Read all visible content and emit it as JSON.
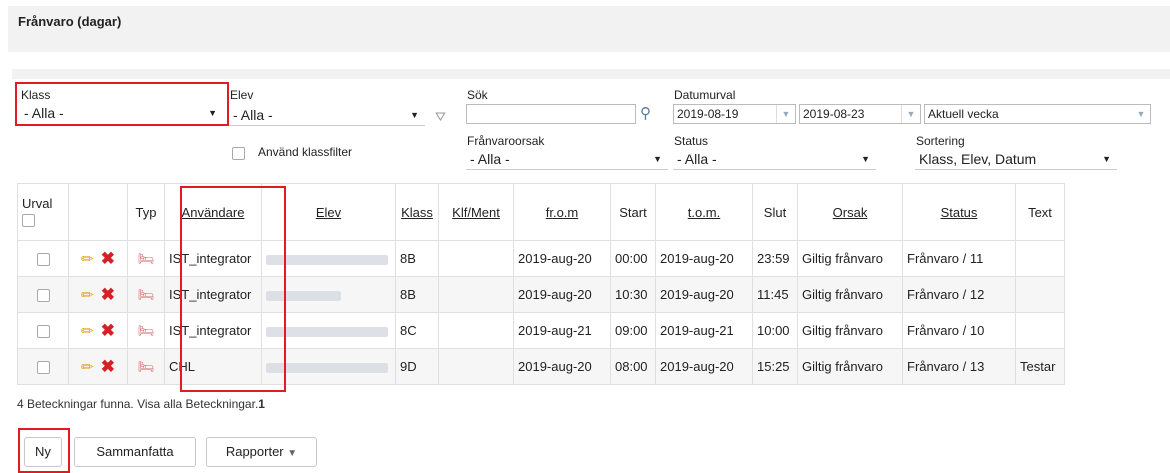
{
  "header": {
    "title": "Frånvaro (dagar)"
  },
  "filters": {
    "klass_label": "Klass",
    "klass_value": "- Alla -",
    "elev_label": "Elev",
    "elev_value": "- Alla -",
    "sok_label": "Sök",
    "sok_value": "",
    "datum_label": "Datumurval",
    "date_from": "2019-08-19",
    "date_to": "2019-08-23",
    "period_value": "Aktuell vecka",
    "franvaro_label": "Frånvaroorsak",
    "franvaro_value": "- Alla -",
    "status_label": "Status",
    "status_value": "- Alla -",
    "sort_label": "Sortering",
    "sort_value": "Klass, Elev, Datum",
    "klassfilter_label": "Använd klassfilter"
  },
  "table": {
    "headers": {
      "urval": "Urval",
      "typ": "Typ",
      "anvandare": "Användare",
      "elev": "Elev",
      "klass": "Klass",
      "klfment": "Klf/Ment",
      "from": "fr.o.m",
      "start": "Start",
      "tom": "t.o.m.",
      "slut": "Slut",
      "orsak": "Orsak",
      "status": "Status",
      "text": "Text"
    },
    "rows": [
      {
        "user": "IST_integrator",
        "klass": "8B",
        "from": "2019-aug-20",
        "start": "00:00",
        "tom": "2019-aug-20",
        "slut": "23:59",
        "orsak": "Giltig frånvaro",
        "status": "Frånvaro / 11",
        "text": ""
      },
      {
        "user": "IST_integrator",
        "klass": "8B",
        "from": "2019-aug-20",
        "start": "10:30",
        "tom": "2019-aug-20",
        "slut": "11:45",
        "orsak": "Giltig frånvaro",
        "status": "Frånvaro / 12",
        "text": ""
      },
      {
        "user": "IST_integrator",
        "klass": "8C",
        "from": "2019-aug-21",
        "start": "09:00",
        "tom": "2019-aug-21",
        "slut": "10:00",
        "orsak": "Giltig frånvaro",
        "status": "Frånvaro / 10",
        "text": ""
      },
      {
        "user": "CHL",
        "klass": "9D",
        "from": "2019-aug-20",
        "start": "08:00",
        "tom": "2019-aug-20",
        "slut": "15:25",
        "orsak": "Giltig frånvaro",
        "status": "Frånvaro / 13",
        "text": "Testar"
      }
    ]
  },
  "found_text": "4 Beteckningar funna. Visa alla Beteckningar.",
  "found_count": "1",
  "buttons": {
    "ny": "Ny",
    "sammanfatta": "Sammanfatta",
    "rapporter": "Rapporter"
  }
}
